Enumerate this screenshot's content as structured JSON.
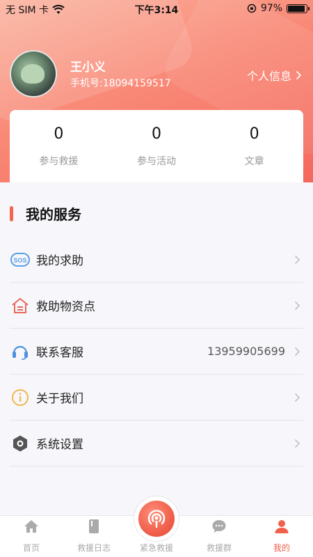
{
  "status_bar": {
    "carrier": "无 SIM 卡",
    "time": "下午3:14",
    "battery": "97%"
  },
  "profile": {
    "name": "王小义",
    "phone": "手机号:18094159517",
    "info_link": "个人信息"
  },
  "stats": [
    {
      "value": "0",
      "label": "参与救援"
    },
    {
      "value": "0",
      "label": "参与活动"
    },
    {
      "value": "0",
      "label": "文章"
    }
  ],
  "services": {
    "title": "我的服务",
    "items": [
      {
        "label": "我的求助",
        "value": "",
        "icon": "sos-icon"
      },
      {
        "label": "救助物资点",
        "value": "",
        "icon": "warehouse-icon"
      },
      {
        "label": "联系客服",
        "value": "13959905699",
        "icon": "headset-icon"
      },
      {
        "label": "关于我们",
        "value": "",
        "icon": "info-icon"
      },
      {
        "label": "系统设置",
        "value": "",
        "icon": "settings-icon"
      }
    ]
  },
  "tabbar": {
    "items": [
      {
        "label": "首页",
        "icon": "home-icon"
      },
      {
        "label": "救援日志",
        "icon": "log-icon"
      },
      {
        "label": "紧急救援",
        "icon": "podcast-icon"
      },
      {
        "label": "救援群",
        "icon": "chat-icon"
      },
      {
        "label": "我的",
        "icon": "person-icon"
      }
    ],
    "active": "我的"
  },
  "colors": {
    "accent": "#f0604c",
    "muted": "#aaaaaa"
  }
}
